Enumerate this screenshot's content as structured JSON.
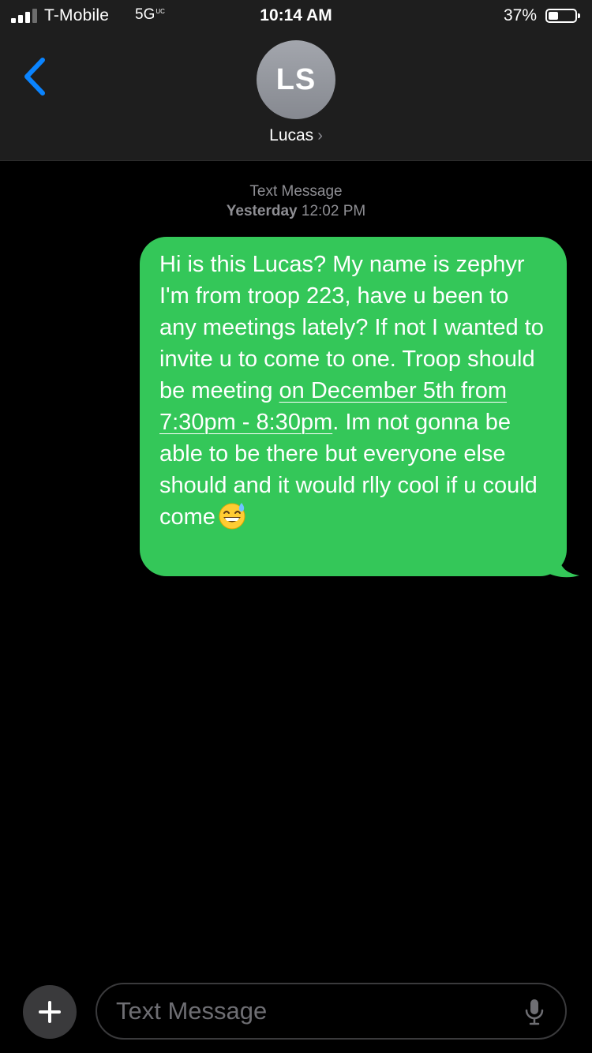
{
  "status_bar": {
    "carrier": "T-Mobile",
    "network": "5G",
    "network_badge": "UC",
    "time": "10:14 AM",
    "battery_percent": "37%",
    "battery_level": 0.37,
    "signal_bars_active": 3,
    "signal_bars_total": 4
  },
  "nav": {
    "back_icon": "chevron-left-icon",
    "contact_initials": "LS",
    "contact_name": "Lucas",
    "contact_chevron": "›"
  },
  "conversation": {
    "service_label": "Text Message",
    "day": "Yesterday",
    "time": "12:02 PM",
    "messages": [
      {
        "direction": "outgoing",
        "text_before_link": "Hi is this Lucas? My name is zephyr I'm from troop 223, have u been to any meetings lately? If not I wanted to invite u to come to one. Troop should be meeting ",
        "link_text": "on December 5th from 7:30pm - 8:30pm",
        "text_after_link": ". Im not gonna be able to be there but everyone else should and it would rlly cool if u could come",
        "emoji": "grinning-face-with-sweat"
      }
    ]
  },
  "composer": {
    "placeholder": "Text Message",
    "value": "",
    "plus_icon": "plus-icon",
    "mic_icon": "microphone-icon"
  },
  "colors": {
    "header_bg": "#1e1e1e",
    "bubble_outgoing": "#34c759",
    "accent_blue": "#0a84ff",
    "secondary_text": "#8e8e93",
    "background": "#000000"
  }
}
